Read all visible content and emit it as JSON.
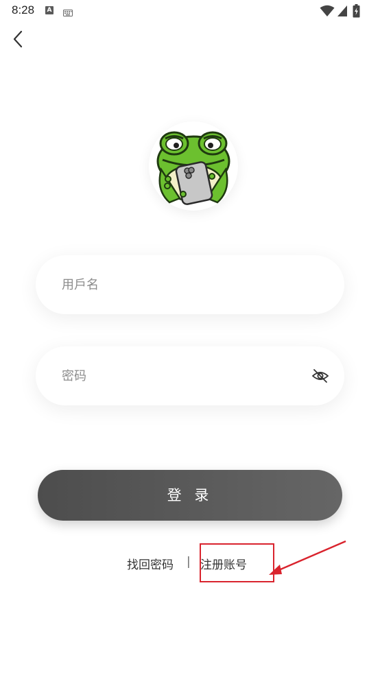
{
  "status_bar": {
    "time": "8:28",
    "a_icon_letter": "A",
    "icons": [
      "a-notification-icon",
      "keyboard-icon",
      "wifi-icon",
      "signal-icon",
      "battery-icon"
    ]
  },
  "header": {
    "back_icon": "chevron-left-icon"
  },
  "logo": {
    "icon": "frog-mascot-logo"
  },
  "form": {
    "username_placeholder": "用戶名",
    "username_value": "",
    "password_placeholder": "密码",
    "password_value": "",
    "password_toggle_icon": "eye-off-icon",
    "login_label": "登 录"
  },
  "links": {
    "forgot_password": "找回密码",
    "separator": "|",
    "register": "注册账号"
  },
  "annotation": {
    "color": "#d9232d"
  },
  "colors": {
    "button_start": "#4d4d4d",
    "button_end": "#666666",
    "frog_green": "#66bb2e"
  }
}
